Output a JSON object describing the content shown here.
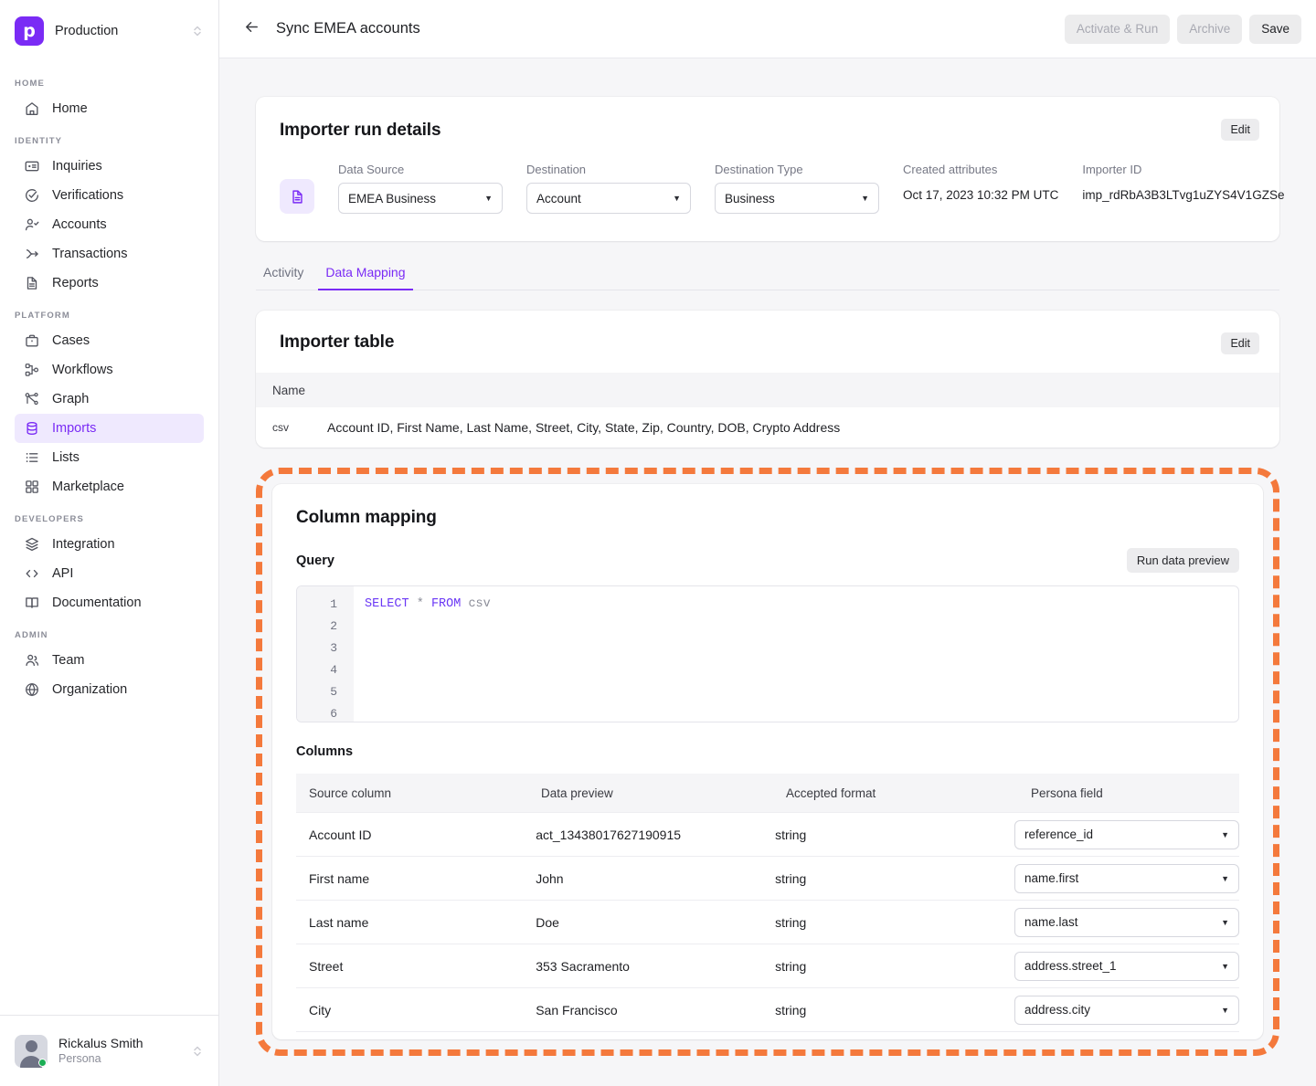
{
  "sidebar": {
    "org": {
      "logo_letter": "p",
      "name": "Production",
      "switch_icon": "chevron-up-down-icon"
    },
    "sections": [
      {
        "label": "HOME",
        "items": [
          {
            "label": "Home",
            "icon": "home-icon",
            "active": false
          }
        ]
      },
      {
        "label": "IDENTITY",
        "items": [
          {
            "label": "Inquiries",
            "icon": "id-card-icon",
            "active": false
          },
          {
            "label": "Verifications",
            "icon": "check-circle-icon",
            "active": false
          },
          {
            "label": "Accounts",
            "icon": "user-check-icon",
            "active": false
          },
          {
            "label": "Transactions",
            "icon": "transactions-arrow-icon",
            "active": false
          },
          {
            "label": "Reports",
            "icon": "document-icon",
            "active": false
          }
        ]
      },
      {
        "label": "PLATFORM",
        "items": [
          {
            "label": "Cases",
            "icon": "briefcase-icon",
            "active": false
          },
          {
            "label": "Workflows",
            "icon": "workflow-icon",
            "active": false
          },
          {
            "label": "Graph",
            "icon": "graph-icon",
            "active": false
          },
          {
            "label": "Imports",
            "icon": "database-icon",
            "active": true
          },
          {
            "label": "Lists",
            "icon": "list-icon",
            "active": false
          },
          {
            "label": "Marketplace",
            "icon": "grid-icon",
            "active": false
          }
        ]
      },
      {
        "label": "DEVELOPERS",
        "items": [
          {
            "label": "Integration",
            "icon": "layers-icon",
            "active": false
          },
          {
            "label": "API",
            "icon": "code-brackets-icon",
            "active": false
          },
          {
            "label": "Documentation",
            "icon": "book-icon",
            "active": false
          }
        ]
      },
      {
        "label": "ADMIN",
        "items": [
          {
            "label": "Team",
            "icon": "users-icon",
            "active": false
          },
          {
            "label": "Organization",
            "icon": "globe-icon",
            "active": false
          }
        ]
      }
    ],
    "user": {
      "name": "Rickalus Smith",
      "subtitle": "Persona",
      "status": "online",
      "switch_icon": "chevron-up-down-icon"
    }
  },
  "topbar": {
    "back_icon": "arrow-left-icon",
    "title": "Sync EMEA accounts",
    "buttons": [
      {
        "label": "Activate & Run",
        "disabled": true
      },
      {
        "label": "Archive",
        "disabled": true
      },
      {
        "label": "Save",
        "disabled": false
      }
    ]
  },
  "run_details": {
    "title": "Importer run details",
    "edit_label": "Edit",
    "icon": "file-document-icon",
    "fields": [
      {
        "label": "Data Source",
        "value": "EMEA Business",
        "type": "select"
      },
      {
        "label": "Destination",
        "value": "Account",
        "type": "select"
      },
      {
        "label": "Destination Type",
        "value": "Business",
        "type": "select"
      }
    ],
    "created_attributes": {
      "label": "Created attributes",
      "value": "Oct 17, 2023 10:32 PM UTC"
    },
    "importer_id": {
      "label": "Importer ID",
      "value": "imp_rdRbA3B3LTvg1uZYS4V1GZSe"
    }
  },
  "tabs": [
    {
      "label": "Activity",
      "active": false
    },
    {
      "label": "Data Mapping",
      "active": true
    }
  ],
  "importer_table": {
    "title": "Importer table",
    "edit_label": "Edit",
    "header": "Name",
    "rows": [
      {
        "type": "csv",
        "name": "Account ID, First Name, Last Name, Street, City, State, Zip, Country, DOB, Crypto Address"
      }
    ]
  },
  "column_mapping": {
    "title": "Column mapping",
    "query_label": "Query",
    "run_preview_label": "Run data preview",
    "editor": {
      "line_numbers": [
        "1",
        "2",
        "3",
        "4",
        "5",
        "6"
      ],
      "code_keyword_1": "SELECT",
      "code_operator": "*",
      "code_keyword_2": "FROM",
      "code_table": "csv"
    },
    "columns_label": "Columns",
    "table_headers": [
      "Source column",
      "Data preview",
      "Accepted format",
      "Persona field"
    ],
    "rows": [
      {
        "source": "Account ID",
        "preview": "act_13438017627190915",
        "format": "string",
        "field": "reference_id"
      },
      {
        "source": "First name",
        "preview": "John",
        "format": "string",
        "field": "name.first"
      },
      {
        "source": "Last name",
        "preview": "Doe",
        "format": "string",
        "field": "name.last"
      },
      {
        "source": "Street",
        "preview": "353 Sacramento",
        "format": "string",
        "field": "address.street_1"
      },
      {
        "source": "City",
        "preview": "San Francisco",
        "format": "string",
        "field": "address.city"
      }
    ]
  },
  "colors": {
    "accent_purple": "#7A2BF5",
    "accent_purple_bg": "#EFE9FE",
    "highlight_orange": "#F4793C",
    "page_bg": "#F6F6F8",
    "online_green": "#1CAE55"
  }
}
